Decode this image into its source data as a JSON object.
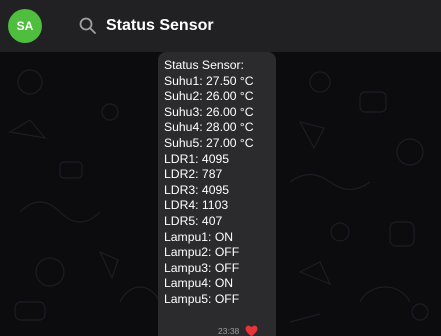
{
  "header": {
    "avatar_initials": "SA",
    "avatar_color": "#4fbd3e",
    "search_icon": "search-icon",
    "search_query": "Status Sensor"
  },
  "message": {
    "lines": [
      "Status Sensor:",
      "Suhu1: 27.50 °C",
      "Suhu2: 26.00 °C",
      "Suhu3: 26.00 °C",
      "Suhu4: 28.00 °C",
      "Suhu5: 27.00 °C",
      "LDR1: 4095",
      "LDR2: 787",
      "LDR3: 4095",
      "LDR4: 1103",
      "LDR5: 407",
      "Lampu1: ON",
      "Lampu2: OFF",
      "Lampu3: OFF",
      "Lampu4: ON",
      "Lampu5: OFF"
    ],
    "time": "23:38",
    "reaction_icon": "heart-icon",
    "reaction_color": "#e8333b"
  }
}
